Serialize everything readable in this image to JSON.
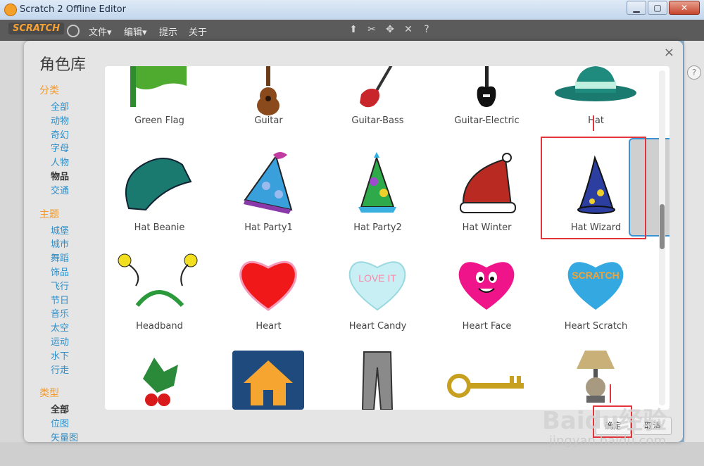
{
  "window": {
    "title": "Scratch 2 Offline Editor",
    "min": "▁",
    "max": "▢",
    "close": "✕"
  },
  "menubar": {
    "logo": "SCRATCH",
    "file": "文件▾",
    "edit": "编辑▾",
    "tips": "提示",
    "about": "关于"
  },
  "toolbar_icons": [
    "duplicate-icon",
    "cut-icon",
    "grow-icon",
    "shrink-icon",
    "help-icon"
  ],
  "dialog": {
    "title": "角色库",
    "close": "×",
    "sidebar": {
      "category_title": "分类",
      "categories": [
        "全部",
        "动物",
        "奇幻",
        "字母",
        "人物",
        "物品",
        "交通"
      ],
      "category_selected": "物品",
      "theme_title": "主题",
      "themes": [
        "城堡",
        "城市",
        "舞蹈",
        "饰品",
        "飞行",
        "节日",
        "音乐",
        "太空",
        "运动",
        "水下",
        "行走"
      ],
      "type_title": "类型",
      "types": [
        "全部",
        "位图",
        "矢量图"
      ],
      "type_selected": "全部"
    },
    "sprites": [
      "Green Flag",
      "Guitar",
      "Guitar-Bass",
      "Guitar-Electric",
      "Hat",
      "Hat Beanie",
      "Hat Party1",
      "Hat Party2",
      "Hat Winter",
      "Hat Wizard",
      "Headband",
      "Heart",
      "Heart Candy",
      "Heart Face",
      "Heart Scratch",
      "",
      "",
      "",
      "",
      ""
    ],
    "selected_sprite": "Hat Wizard",
    "ok_label": "确定",
    "cancel_label": "取消"
  },
  "watermark": {
    "line1": "Baidu经验",
    "line2": "jingyan.baidu.com"
  },
  "colors": {
    "accent": "#3a93d2",
    "highlight_red": "#e1343b",
    "category_orange": "#f39a2b",
    "link_blue": "#2f8fc9"
  }
}
